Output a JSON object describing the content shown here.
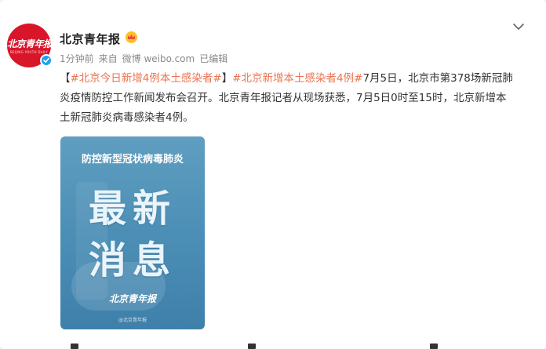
{
  "author": {
    "name": "北京青年报",
    "avatar_logo": "北京青年报",
    "avatar_sub": "BEIJING YOUTH DAILY",
    "badge_color": "#1ea0f2",
    "crown_icon": "crown-icon"
  },
  "meta": {
    "time": "1分钟前",
    "source_label": "来自",
    "source": "微博 weibo.com",
    "edited": "已编辑"
  },
  "post": {
    "bracket_open": "【",
    "tag1": "#北京今日新增4例本土感染者#",
    "bracket_close": "】",
    "tag2": "#北京新增本土感染者4例#",
    "text": "7月5日，北京市第378场新冠肺炎疫情防控工作新闻发布会召开。北京青年报记者从现场获悉，7月5日0时至15时，北京新增本土新冠肺炎病毒感染者4例。",
    "tag_color": "#eb7350"
  },
  "image": {
    "top_title": "防控新型冠状病毒肺炎",
    "line1": "最新",
    "line2": "消息",
    "brand": "北京青年报",
    "watermark": "@北京青年报"
  }
}
